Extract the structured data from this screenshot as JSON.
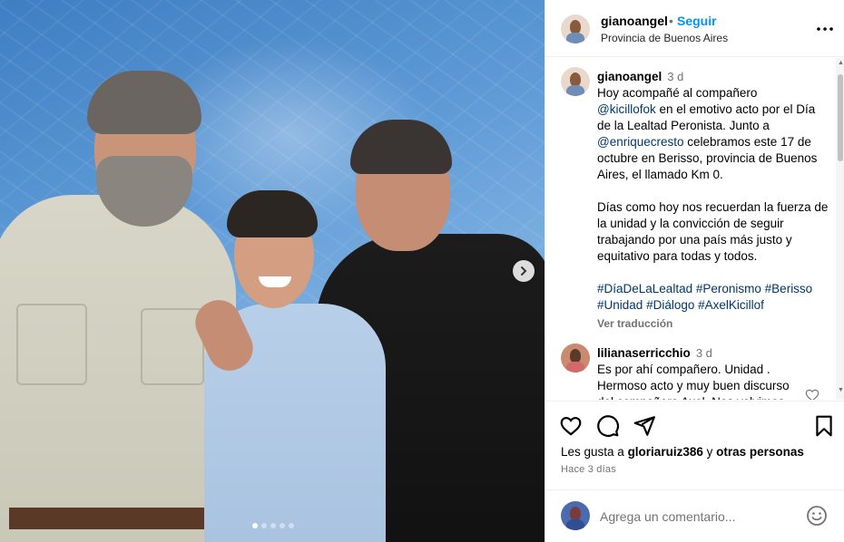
{
  "post": {
    "image_alt": "Three men posing together in front of a blue tarp",
    "carousel": {
      "dots": 5,
      "active_index": 0
    }
  },
  "header": {
    "username": "gianoangel",
    "separator": "•",
    "follow_label": "Seguir",
    "location": "Provincia de Buenos Aires"
  },
  "caption": {
    "username": "gianoangel",
    "time": "3 d",
    "p1_a": "Hoy acompañé al compañero",
    "mention1": "@kicillofok",
    "p1_b": " en el emotivo acto por el Día de la Lealtad Peronista. Junto a",
    "mention2": "@enriquecresto",
    "p1_c": " celebramos este 17 de octubre en Berisso, provincia de Buenos Aires, el llamado Km 0.",
    "p2": "Días como hoy nos recuerdan la fuerza de la unidad y la convicción de seguir trabajando por una país más justo y equitativo para todas y todos.",
    "hashtags": [
      "#DíaDeLaLealtad",
      "#Peronismo",
      "#Berisso",
      "#Unidad",
      "#Diálogo",
      "#AxelKicillof"
    ],
    "translate_label": "Ver traducción"
  },
  "comment": {
    "username": "lilianaserricchio",
    "time": "3 d",
    "text": "Es por ahí compañero. Unidad . Hermoso acto y muy buen discurso del compañero Axel. Nos volvimos"
  },
  "likes": {
    "prefix": "Les gusta a ",
    "user": "gloriaruiz386",
    "middle": " y ",
    "others": "otras personas"
  },
  "ago": "Hace 3 días",
  "add_comment": {
    "placeholder": "Agrega un comentario..."
  }
}
